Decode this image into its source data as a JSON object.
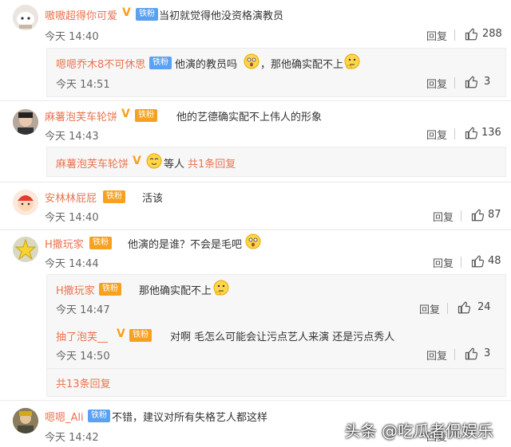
{
  "comments": [
    {
      "name": "嗷嗷超得你可爱",
      "badge": "铁粉",
      "text": "当初就觉得他没资格演教员",
      "time": "今天 14:40",
      "reply_label": "回复",
      "likes": "288"
    },
    {
      "name": "嗯嗯乔木8不可休思",
      "badge": "铁粉",
      "text": "他演的教员吗",
      "text2": "，那他确实配不上",
      "time": "今天 14:51",
      "reply_label": "回复",
      "likes": "3"
    },
    {
      "name": "麻薯泡芙车轮饼",
      "badge": "铁粉",
      "text": "他的艺德确实配不上伟人的形象",
      "time": "今天 14:43",
      "reply_label": "回复",
      "likes": "136"
    },
    {
      "name": "麻薯泡芙车轮饼",
      "text": "等人",
      "more": "共1条回复"
    },
    {
      "name": "安林林屁屁",
      "badge": "铁粉",
      "text": "活该",
      "time": "今天 14:40",
      "reply_label": "回复",
      "likes": "87"
    },
    {
      "name": "H撒玩家",
      "badge": "铁粉",
      "text": "他演的是谁？不会是毛吧",
      "time": "今天 14:44",
      "reply_label": "回复",
      "likes": "48"
    },
    {
      "name": "H撒玩家",
      "badge": "铁粉",
      "text": "那他确实配不上",
      "time": "今天 14:47",
      "reply_label": "回复",
      "likes": "24"
    },
    {
      "name": "抽了泡芙__",
      "badge": "铁粉",
      "text": "对啊 毛怎么可能会让污点艺人来演 还是污点秀人",
      "time": "今天 14:50",
      "reply_label": "回复",
      "likes": "3"
    },
    {
      "more": "共13条回复"
    },
    {
      "name": "嗯嗯_Ali",
      "badge": "铁粉",
      "text": "不错，建议对所有失格艺人都这样",
      "time": "今天 14:42",
      "reply_label": "回复"
    }
  ],
  "watermark": "头条 @吃瓜者侃娱乐",
  "colors": {
    "name": "#eb7350",
    "badge_blue": "#5aa1f1",
    "badge_orange": "#f6a11f",
    "text": "#333333",
    "muted": "#666666"
  },
  "icons": [
    "like-icon",
    "emoji-icon",
    "vip-v-icon"
  ]
}
